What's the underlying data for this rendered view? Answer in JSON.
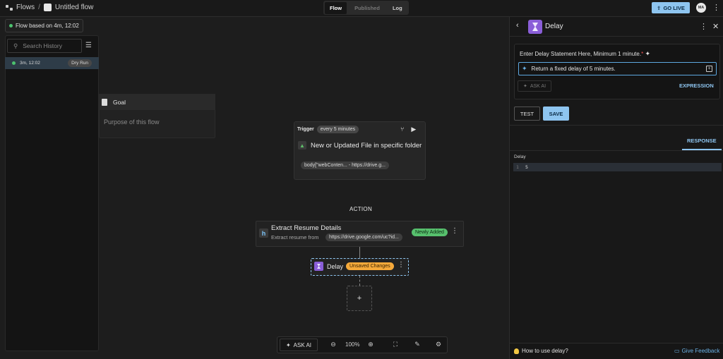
{
  "header": {
    "flows_label": "Flows",
    "separator": "/",
    "flow_name": "Untitled flow",
    "tabs": [
      {
        "label": "Flow"
      },
      {
        "label": "Published"
      },
      {
        "label": "Log"
      }
    ],
    "go_live_label": "GO LIVE",
    "avatar_initials": "MA"
  },
  "history": {
    "flow_based_label": "Flow based on 4m, 12:02",
    "search_placeholder": "Search History",
    "rows": [
      {
        "time": "3m, 12:02",
        "badge": "Dry Run"
      }
    ]
  },
  "goal": {
    "title": "Goal",
    "placeholder": "Purpose of this flow"
  },
  "trigger": {
    "label": "Trigger",
    "schedule": "every 5 minutes",
    "title": "New or Updated File in specific folder",
    "chip": "body[\"webConten... - https://drive.g..."
  },
  "action_label": "ACTION",
  "extract": {
    "title": "Extract Resume Details",
    "subtitle": "Extract resume from",
    "chip": "https://drive.google.com/uc?id...",
    "badge": "Newly Added"
  },
  "delay_node": {
    "title": "Delay",
    "badge": "Unsaved Changes"
  },
  "add_symbol": "+",
  "toolbar": {
    "ask_ai": "ASK AI",
    "zoom": "100%"
  },
  "panel": {
    "title": "Delay",
    "statement_label": "Enter Delay Statement Here, Minimum 1 minute.",
    "required_mark": "*",
    "input_value": "Return a fixed delay of 5 minutes.",
    "ask_ai": "ASK AI",
    "expression": "EXPRESSION",
    "test": "TEST",
    "save": "SAVE",
    "response_tab": "RESPONSE",
    "response_field": "Delay",
    "line_number": "1",
    "line_value": "5",
    "how_to": "How to use delay?",
    "feedback": "Give Feedback"
  },
  "colors": {
    "accent": "#8ec5f0",
    "success": "#57c06d",
    "warning": "#f5a93a",
    "delay_purple": "#8a5ed8"
  }
}
